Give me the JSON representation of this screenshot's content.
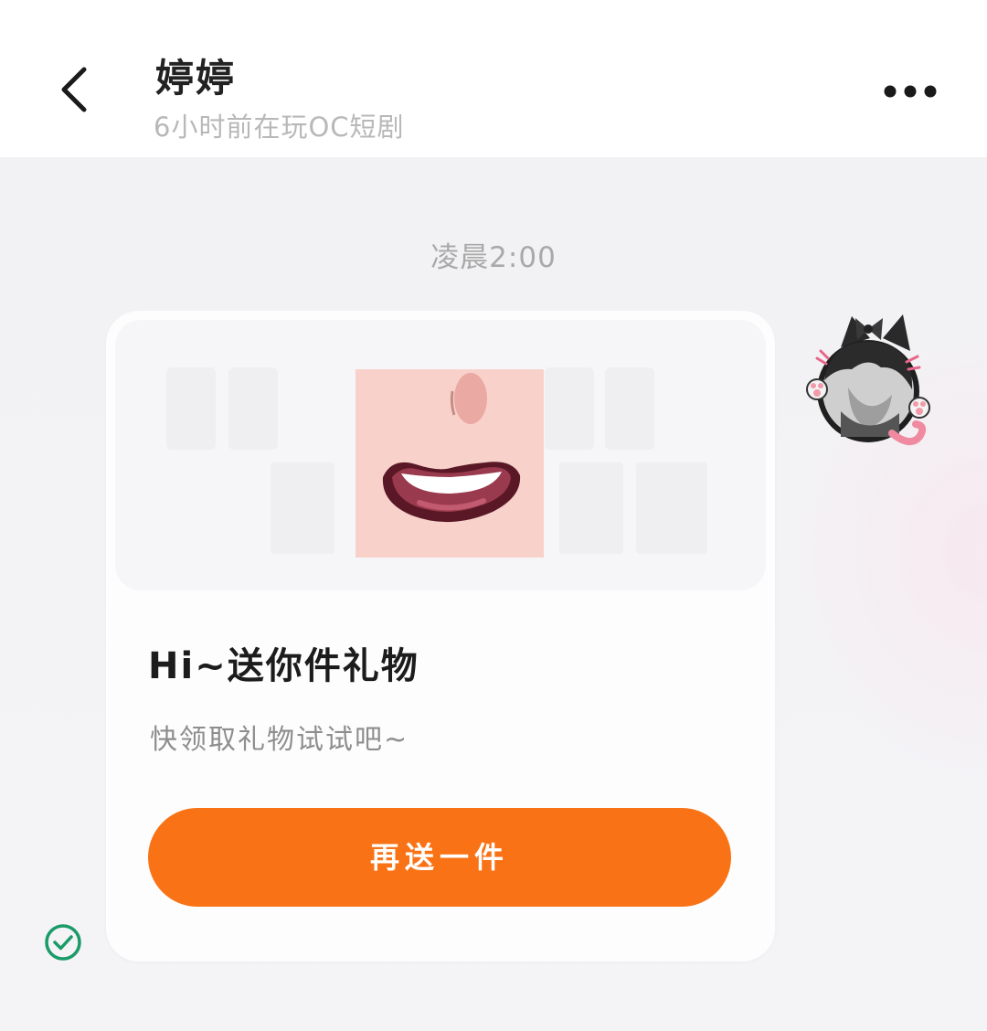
{
  "header": {
    "contact_name": "婷婷",
    "status": "6小时前在玩OC短剧",
    "back_icon": "chevron-left-icon",
    "more_icon": "more-horizontal-icon"
  },
  "chat": {
    "timestamp": "凌晨2:00",
    "message": {
      "type": "gift-card",
      "avatar_icon": "cat-ear-avatar",
      "gift_image_icon": "smiling-mouth-sticker",
      "title": "Hi~送你件礼物",
      "subtitle": "快领取礼物试试吧~",
      "button_label": "再送一件",
      "status_icon": "check-circle-icon"
    }
  },
  "colors": {
    "accent": "#f97316",
    "sent_status": "#1a9b68",
    "header_bg": "#ffffff",
    "chat_bg": "#f3f3f5",
    "title_text": "#1c1c1c",
    "muted_text": "#a9a9a9"
  }
}
